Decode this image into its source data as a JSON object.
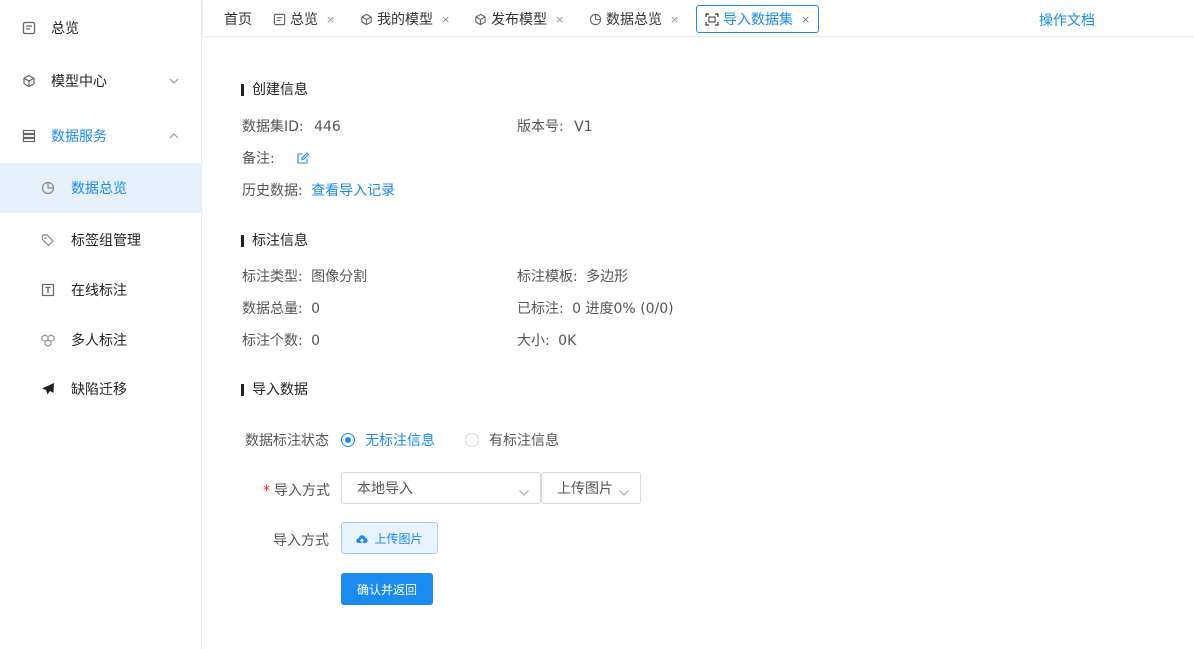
{
  "sidebar": {
    "items": [
      {
        "label": "总览",
        "icon": "overview-icon"
      },
      {
        "label": "模型中心",
        "icon": "cube-icon",
        "expanded": false
      },
      {
        "label": "数据服务",
        "icon": "storage-icon",
        "expanded": true
      },
      {
        "label": "数据总览",
        "icon": "pie-chart-icon",
        "active": true
      },
      {
        "label": "标签组管理",
        "icon": "tag-icon"
      },
      {
        "label": "在线标注",
        "icon": "text-box-icon"
      },
      {
        "label": "多人标注",
        "icon": "cubes-icon"
      },
      {
        "label": "缺陷迁移",
        "icon": "paper-plane-icon"
      }
    ]
  },
  "tabs": [
    {
      "label": "首页"
    },
    {
      "label": "总览",
      "icon": "overview-icon",
      "closable": true
    },
    {
      "label": "我的模型",
      "icon": "cube-icon",
      "closable": true
    },
    {
      "label": "发布模型",
      "icon": "cube-icon",
      "closable": true
    },
    {
      "label": "数据总览",
      "icon": "pie-chart-icon",
      "closable": true
    },
    {
      "label": "导入数据集",
      "icon": "scan-icon",
      "closable": true,
      "active": true
    }
  ],
  "tab_close_glyph": "×",
  "doc_link": "操作文档",
  "create_info": {
    "title": "创建信息",
    "dataset_id_label": "数据集ID:",
    "dataset_id": "446",
    "version_label": "版本号:",
    "version": "V1",
    "remark_label": "备注:",
    "history_label": "历史数据:",
    "history_link": "查看导入记录"
  },
  "annotation_info": {
    "title": "标注信息",
    "type_label": "标注类型:",
    "type": "图像分割",
    "template_label": "标注模板:",
    "template": "多边形",
    "total_label": "数据总量:",
    "total": "0",
    "labeled_label": "已标注:",
    "labeled": "0 进度0% (0/0)",
    "count_label": "标注个数:",
    "count": "0",
    "size_label": "大小:",
    "size": "0K"
  },
  "import_data": {
    "title": "导入数据",
    "status_label": "数据标注状态",
    "status_options": [
      "无标注信息",
      "有标注信息"
    ],
    "status_selected": 0,
    "required_mark": "*",
    "method_label": "导入方式",
    "method_value": "本地导入",
    "method_sub_value": "上传图片",
    "upload_label": "导入方式",
    "upload_button": "上传图片",
    "confirm_button": "确认并返回"
  },
  "colors": {
    "accent": "#1b8bf0",
    "active_bg": "#e6f0fb",
    "required": "#f5222d"
  }
}
